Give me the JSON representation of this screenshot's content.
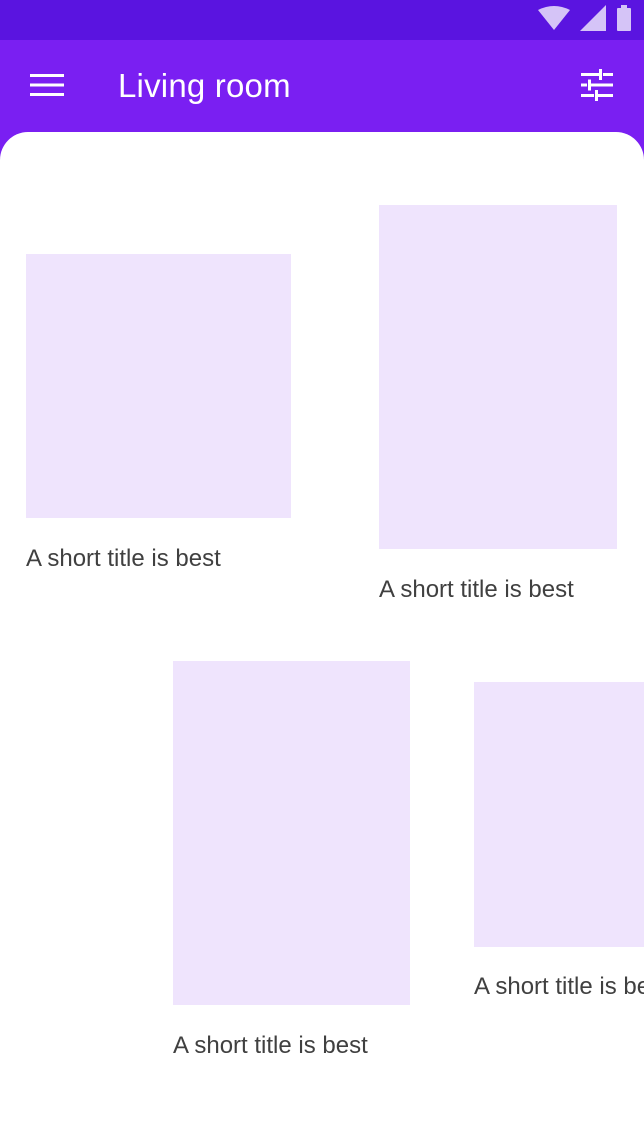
{
  "status_bar": {
    "icons": [
      "wifi-icon",
      "signal-icon",
      "battery-icon"
    ]
  },
  "app_bar": {
    "title": "Living room",
    "nav_icon": "menu-icon",
    "action_icon": "tune-icon"
  },
  "cards": [
    {
      "caption": "A short title is best"
    },
    {
      "caption": "A short title is best"
    },
    {
      "caption": "A short title is best"
    },
    {
      "caption": "A short title is best"
    }
  ],
  "colors": {
    "status_bar": "#5a14e0",
    "app_bar": "#7a1ff2",
    "surface": "#ffffff",
    "thumbnail": "#efe4fd",
    "caption_text": "#404040"
  }
}
